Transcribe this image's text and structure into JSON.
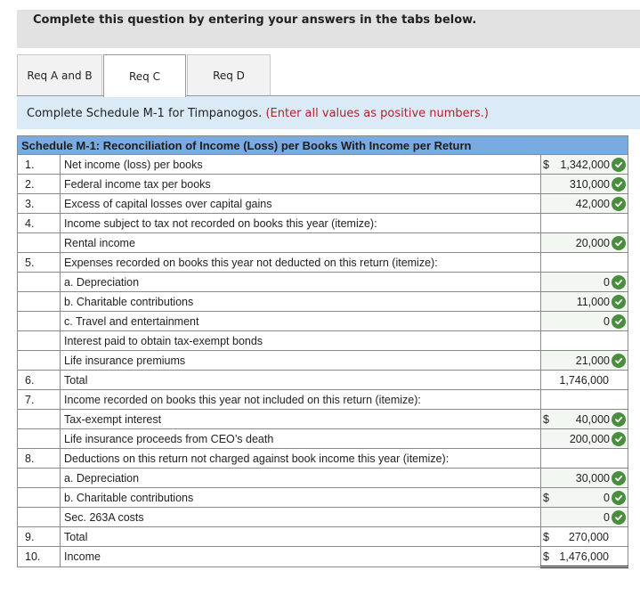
{
  "banner": {
    "text": "Complete this question by entering your answers in the tabs below."
  },
  "tabs": [
    {
      "label": "Req A and B",
      "active": false
    },
    {
      "label": "Req C",
      "active": true
    },
    {
      "label": "Req D",
      "active": false
    }
  ],
  "instructions": {
    "text": "Complete Schedule M-1 for Timpanogos.",
    "note": "(Enter all values as positive numbers.)"
  },
  "schedule": {
    "title": "Schedule M-1: Reconciliation of Income (Loss) per Books With Income per Return",
    "rows": [
      {
        "num": "1.",
        "label": "Net income (loss) per books",
        "dollar": "$",
        "value": "1,342,000",
        "correct": true
      },
      {
        "num": "2.",
        "label": "Federal income tax per books",
        "dollar": "",
        "value": "310,000",
        "correct": true
      },
      {
        "num": "3.",
        "label": "Excess of capital losses over capital gains",
        "dollar": "",
        "value": "42,000",
        "correct": true
      },
      {
        "num": "4.",
        "label": "Income subject to tax not recorded on books this year (itemize):",
        "dollar": "",
        "value": "",
        "correct": false
      },
      {
        "num": "",
        "label": "Rental income",
        "dollar": "",
        "value": "20,000",
        "correct": true
      },
      {
        "num": "5.",
        "label": "Expenses recorded on books this year not deducted on this return (itemize):",
        "dollar": "",
        "value": "",
        "correct": false
      },
      {
        "num": "",
        "label": "a. Depreciation",
        "dollar": "",
        "value": "0",
        "correct": true
      },
      {
        "num": "",
        "label": "b. Charitable contributions",
        "dollar": "",
        "value": "11,000",
        "correct": true
      },
      {
        "num": "",
        "label": "c. Travel and entertainment",
        "dollar": "",
        "value": "0",
        "correct": true
      },
      {
        "num": "",
        "label": "Interest paid to obtain tax-exempt bonds",
        "dollar": "",
        "value": "",
        "correct": false
      },
      {
        "num": "",
        "label": "Life insurance premiums",
        "dollar": "",
        "value": "21,000",
        "correct": true
      },
      {
        "num": "6.",
        "label": "Total",
        "dollar": "",
        "value": "1,746,000",
        "correct": false
      },
      {
        "num": "7.",
        "label": "Income recorded on books this year not included on this return (itemize):",
        "dollar": "",
        "value": "",
        "correct": false
      },
      {
        "num": "",
        "label": "Tax-exempt interest",
        "dollar": "$",
        "value": "40,000",
        "correct": true
      },
      {
        "num": "",
        "label": "Life insurance proceeds from CEO’s death",
        "dollar": "",
        "value": "200,000",
        "correct": true
      },
      {
        "num": "8.",
        "label": "Deductions on this return not charged against book income this year (itemize):",
        "dollar": "",
        "value": "",
        "correct": false
      },
      {
        "num": "",
        "label": "a. Depreciation",
        "dollar": "",
        "value": "30,000",
        "correct": true
      },
      {
        "num": "",
        "label": "b. Charitable contributions",
        "dollar": "$",
        "value": "0",
        "correct": true
      },
      {
        "num": "",
        "label": "Sec. 263A costs",
        "dollar": "",
        "value": "0",
        "correct": true
      },
      {
        "num": "9.",
        "label": "Total",
        "dollar": "$",
        "value": "270,000",
        "correct": false
      },
      {
        "num": "10.",
        "label": "Income",
        "dollar": "$",
        "value": "1,476,000",
        "correct": false
      }
    ]
  },
  "colors": {
    "header_blue": "#7aabe0",
    "check_green": "#4a8d3e",
    "note_red": "#b0232a",
    "instruction_bg": "#dbeaf7"
  }
}
